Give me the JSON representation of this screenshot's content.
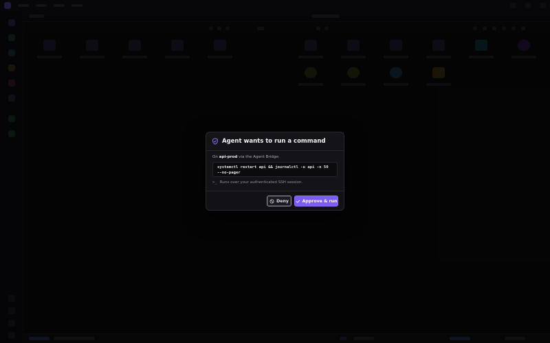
{
  "modal": {
    "title": "Agent wants to run a command",
    "context_prefix": "On ",
    "host": "api-prod",
    "context_suffix": " via the Agent Bridge:",
    "command": "systemctl restart api && journalctl -u api -n 50 --no-pager",
    "note": "Runs over your authenticated SSH session.",
    "icons": {
      "header": "shield-icon",
      "note": "terminal-prompt-icon",
      "deny": "block-icon",
      "approve": "check-icon"
    },
    "deny_label": "Deny",
    "approve_label": "Approve & run"
  },
  "colors": {
    "accent": "#7c5cf2",
    "modal_bg": "#141418",
    "page_bg": "#0a0a0c"
  }
}
